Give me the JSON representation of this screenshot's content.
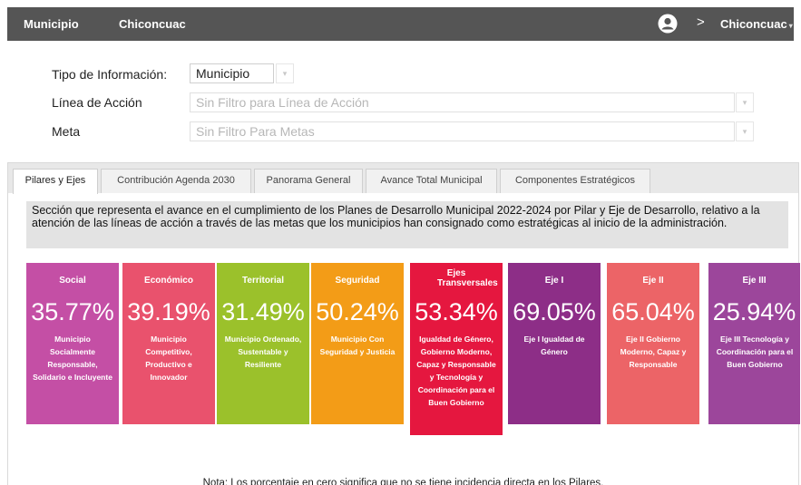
{
  "topbar": {
    "brand": "Municipio",
    "municipality": "Chiconcuac",
    "user_menu_label": "Chiconcuac",
    "caret": "▾",
    "chevron": ">"
  },
  "filters": {
    "tipo_label": "Tipo de Información:",
    "tipo_value": "Municipio",
    "linea_label": "Línea de Acción",
    "linea_value": "Sin Filtro para Línea de Acción",
    "meta_label": "Meta",
    "meta_value": "Sin Filtro Para Metas",
    "arrow": "▾"
  },
  "tabs": [
    {
      "label": "Pilares y Ejes",
      "active": true
    },
    {
      "label": "Contribución Agenda 2030",
      "active": false
    },
    {
      "label": "Panorama General",
      "active": false
    },
    {
      "label": "Avance Total Municipal",
      "active": false
    },
    {
      "label": "Componentes Estratégicos",
      "active": false
    }
  ],
  "description": "Sección que representa el avance en el cumplimiento de los Planes de Desarrollo Municipal 2022-2024 por Pilar y Eje de Desarrollo, relativo a la atención de las líneas de acción a través de las metas que los municipios han consignado como estratégicas al inicio de la administración.",
  "cards": [
    {
      "name": "Social",
      "percent": "35.77%",
      "detail": "Municipio Socialmente Responsable, Solidario e Incluyente",
      "color": "#c44fa5"
    },
    {
      "name": "Económico",
      "percent": "39.19%",
      "detail": "Municipio Competitivo, Productivo e Innovador",
      "color": "#e9526d"
    },
    {
      "name": "Territorial",
      "percent": "31.49%",
      "detail": "Municipio Ordenado, Sustentable y Resiliente",
      "color": "#9bc12b"
    },
    {
      "name": "Seguridad",
      "percent": "50.24%",
      "detail": "Municipio Con Seguridad y Justicia",
      "color": "#f39c17"
    },
    {
      "name": "Ejes Transversales",
      "percent": "53.34%",
      "detail": "Igualdad de Género, Gobierno Moderno, Capaz y Responsable y Tecnología y Coordinación para el Buen Gobierno",
      "color": "#e5173f"
    },
    {
      "name": "Eje I",
      "percent": "69.05%",
      "detail": "Eje I Igualdad de Género",
      "color": "#8d2e87"
    },
    {
      "name": "Eje II",
      "percent": "65.04%",
      "detail": "Eje II Gobierno Moderno, Capaz y Responsable",
      "color": "#ec6467"
    },
    {
      "name": "Eje III",
      "percent": "25.94%",
      "detail": "Eje III Tecnología y Coordinación para el Buen Gobierno",
      "color": "#9c469b"
    }
  ],
  "note": "Nota: Los porcentaje en cero significa que no se tiene incidencia directa en los Pilares."
}
